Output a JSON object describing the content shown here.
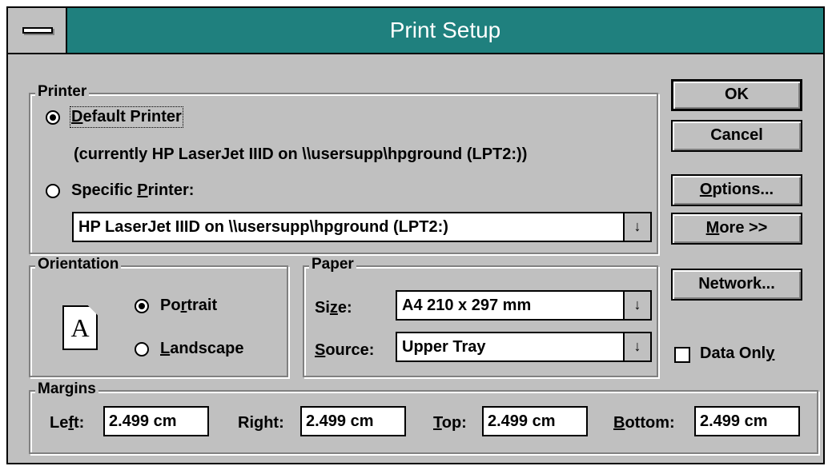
{
  "dialog": {
    "title": "Print Setup"
  },
  "printer": {
    "legend": "Printer",
    "default_pre": "",
    "default_ul": "D",
    "default_post": "efault Printer",
    "current_text": "(currently HP LaserJet IIID on \\\\usersupp\\hpground (LPT2:))",
    "specific_pre": "Specific ",
    "specific_ul": "P",
    "specific_post": "rinter:",
    "specific_value": "HP LaserJet IIID on \\\\usersupp\\hpground (LPT2:)",
    "selected": "default"
  },
  "orientation": {
    "legend": "Orientation",
    "icon_letter": "A",
    "portrait_pre": "Po",
    "portrait_ul": "r",
    "portrait_post": "trait",
    "landscape_pre": "",
    "landscape_ul": "L",
    "landscape_post": "andscape",
    "selected": "portrait"
  },
  "paper": {
    "legend": "Paper",
    "size_pre": "Si",
    "size_ul": "z",
    "size_post": "e:",
    "size_value": "A4 210 x 297 mm",
    "source_pre": "",
    "source_ul": "S",
    "source_post": "ource:",
    "source_value": "Upper Tray"
  },
  "margins": {
    "legend": "Margins",
    "left_pre": "Le",
    "left_ul": "f",
    "left_post": "t:",
    "left_value": "2.499 cm",
    "right_pre": "Ri",
    "right_ul": "g",
    "right_post": "ht:",
    "right_value": "2.499 cm",
    "top_pre": "",
    "top_ul": "T",
    "top_post": "op:",
    "top_value": "2.499 cm",
    "bottom_pre": "",
    "bottom_ul": "B",
    "bottom_post": "ottom:",
    "bottom_value": "2.499 cm"
  },
  "buttons": {
    "ok": "OK",
    "cancel": "Cancel",
    "options_ul": "O",
    "options_post": "ptions...",
    "more_ul": "M",
    "more_post": "ore >>",
    "network": "Network..."
  },
  "data_only": {
    "pre": "Data Onl",
    "ul": "y",
    "checked": false
  },
  "icons": {
    "dropdown": "↓"
  }
}
